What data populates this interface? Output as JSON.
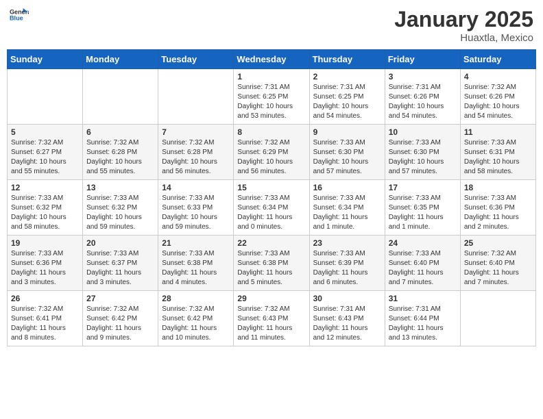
{
  "header": {
    "logo_general": "General",
    "logo_blue": "Blue",
    "month": "January 2025",
    "location": "Huaxtla, Mexico"
  },
  "weekdays": [
    "Sunday",
    "Monday",
    "Tuesday",
    "Wednesday",
    "Thursday",
    "Friday",
    "Saturday"
  ],
  "weeks": [
    [
      {
        "day": "",
        "info": ""
      },
      {
        "day": "",
        "info": ""
      },
      {
        "day": "",
        "info": ""
      },
      {
        "day": "1",
        "info": "Sunrise: 7:31 AM\nSunset: 6:25 PM\nDaylight: 10 hours\nand 53 minutes."
      },
      {
        "day": "2",
        "info": "Sunrise: 7:31 AM\nSunset: 6:25 PM\nDaylight: 10 hours\nand 54 minutes."
      },
      {
        "day": "3",
        "info": "Sunrise: 7:31 AM\nSunset: 6:26 PM\nDaylight: 10 hours\nand 54 minutes."
      },
      {
        "day": "4",
        "info": "Sunrise: 7:32 AM\nSunset: 6:26 PM\nDaylight: 10 hours\nand 54 minutes."
      }
    ],
    [
      {
        "day": "5",
        "info": "Sunrise: 7:32 AM\nSunset: 6:27 PM\nDaylight: 10 hours\nand 55 minutes."
      },
      {
        "day": "6",
        "info": "Sunrise: 7:32 AM\nSunset: 6:28 PM\nDaylight: 10 hours\nand 55 minutes."
      },
      {
        "day": "7",
        "info": "Sunrise: 7:32 AM\nSunset: 6:28 PM\nDaylight: 10 hours\nand 56 minutes."
      },
      {
        "day": "8",
        "info": "Sunrise: 7:32 AM\nSunset: 6:29 PM\nDaylight: 10 hours\nand 56 minutes."
      },
      {
        "day": "9",
        "info": "Sunrise: 7:33 AM\nSunset: 6:30 PM\nDaylight: 10 hours\nand 57 minutes."
      },
      {
        "day": "10",
        "info": "Sunrise: 7:33 AM\nSunset: 6:30 PM\nDaylight: 10 hours\nand 57 minutes."
      },
      {
        "day": "11",
        "info": "Sunrise: 7:33 AM\nSunset: 6:31 PM\nDaylight: 10 hours\nand 58 minutes."
      }
    ],
    [
      {
        "day": "12",
        "info": "Sunrise: 7:33 AM\nSunset: 6:32 PM\nDaylight: 10 hours\nand 58 minutes."
      },
      {
        "day": "13",
        "info": "Sunrise: 7:33 AM\nSunset: 6:32 PM\nDaylight: 10 hours\nand 59 minutes."
      },
      {
        "day": "14",
        "info": "Sunrise: 7:33 AM\nSunset: 6:33 PM\nDaylight: 10 hours\nand 59 minutes."
      },
      {
        "day": "15",
        "info": "Sunrise: 7:33 AM\nSunset: 6:34 PM\nDaylight: 11 hours\nand 0 minutes."
      },
      {
        "day": "16",
        "info": "Sunrise: 7:33 AM\nSunset: 6:34 PM\nDaylight: 11 hours\nand 1 minute."
      },
      {
        "day": "17",
        "info": "Sunrise: 7:33 AM\nSunset: 6:35 PM\nDaylight: 11 hours\nand 1 minute."
      },
      {
        "day": "18",
        "info": "Sunrise: 7:33 AM\nSunset: 6:36 PM\nDaylight: 11 hours\nand 2 minutes."
      }
    ],
    [
      {
        "day": "19",
        "info": "Sunrise: 7:33 AM\nSunset: 6:36 PM\nDaylight: 11 hours\nand 3 minutes."
      },
      {
        "day": "20",
        "info": "Sunrise: 7:33 AM\nSunset: 6:37 PM\nDaylight: 11 hours\nand 3 minutes."
      },
      {
        "day": "21",
        "info": "Sunrise: 7:33 AM\nSunset: 6:38 PM\nDaylight: 11 hours\nand 4 minutes."
      },
      {
        "day": "22",
        "info": "Sunrise: 7:33 AM\nSunset: 6:38 PM\nDaylight: 11 hours\nand 5 minutes."
      },
      {
        "day": "23",
        "info": "Sunrise: 7:33 AM\nSunset: 6:39 PM\nDaylight: 11 hours\nand 6 minutes."
      },
      {
        "day": "24",
        "info": "Sunrise: 7:33 AM\nSunset: 6:40 PM\nDaylight: 11 hours\nand 7 minutes."
      },
      {
        "day": "25",
        "info": "Sunrise: 7:32 AM\nSunset: 6:40 PM\nDaylight: 11 hours\nand 7 minutes."
      }
    ],
    [
      {
        "day": "26",
        "info": "Sunrise: 7:32 AM\nSunset: 6:41 PM\nDaylight: 11 hours\nand 8 minutes."
      },
      {
        "day": "27",
        "info": "Sunrise: 7:32 AM\nSunset: 6:42 PM\nDaylight: 11 hours\nand 9 minutes."
      },
      {
        "day": "28",
        "info": "Sunrise: 7:32 AM\nSunset: 6:42 PM\nDaylight: 11 hours\nand 10 minutes."
      },
      {
        "day": "29",
        "info": "Sunrise: 7:32 AM\nSunset: 6:43 PM\nDaylight: 11 hours\nand 11 minutes."
      },
      {
        "day": "30",
        "info": "Sunrise: 7:31 AM\nSunset: 6:43 PM\nDaylight: 11 hours\nand 12 minutes."
      },
      {
        "day": "31",
        "info": "Sunrise: 7:31 AM\nSunset: 6:44 PM\nDaylight: 11 hours\nand 13 minutes."
      },
      {
        "day": "",
        "info": ""
      }
    ]
  ]
}
